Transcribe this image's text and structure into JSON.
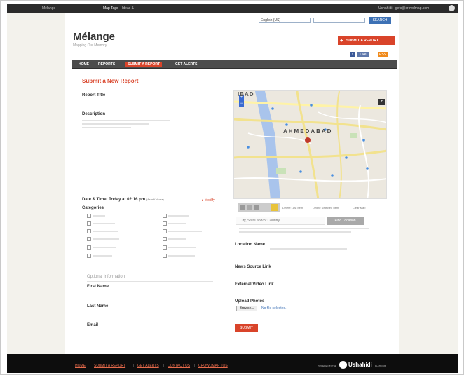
{
  "topbar": {
    "left_1": "Mélange",
    "left_2": "Map Tags",
    "left_3": "Ideas &",
    "right": "Ushahidi - gets@crowdmap.com"
  },
  "search": {
    "select_value": "English (US)",
    "button": "SEARCH"
  },
  "site": {
    "title": "Mélange",
    "tagline": "Mapping Our Memory"
  },
  "header_button": "SUBMIT A REPORT",
  "social": {
    "facebook": "f",
    "like": "Like",
    "rss": "RSS"
  },
  "nav": {
    "items": [
      "HOME",
      "REPORTS",
      "SUBMIT A REPORT",
      "GET ALERTS"
    ]
  },
  "form": {
    "title": "Submit a New Report",
    "report_title": "Report Title",
    "description": "Description",
    "datetime": "Date & Time: Today at 02:16 pm",
    "datetime_note": "(Asia/Kolkata)",
    "modify": "Modify",
    "categories": "Categories",
    "optional": "Optional Information",
    "first_name": "First Name",
    "last_name": "Last Name",
    "email": "Email",
    "location_name": "Location Name",
    "news_link": "News Source Link",
    "video_link": "External Video Link",
    "upload": "Upload Photos",
    "browse": "Browse...",
    "no_file": "No file selected.",
    "submit": "SUBMIT",
    "loc_placeholder": "City, State and/or Country",
    "find": "Find Location"
  },
  "map": {
    "zoom": [
      "+",
      "−"
    ],
    "layers": "+",
    "label_top": "IBAD",
    "label_city": "AHMEDABAD",
    "tools": [
      "Delete Last Item",
      "Delete Selected Item",
      "Clear Map"
    ]
  },
  "footer": {
    "links": [
      "HOME",
      "SUBMIT A REPORT",
      "GET ALERTS",
      "CONTACT US",
      "CROWDMAP TOS"
    ],
    "powered": "POWERED BY THE",
    "brand": "Ushahidi",
    "platform": "PLATFORM"
  },
  "colors": {
    "accent": "#d9442a",
    "nav": "#4c4c4c",
    "footer": "#0d0d0d",
    "link": "#3d71b5"
  }
}
